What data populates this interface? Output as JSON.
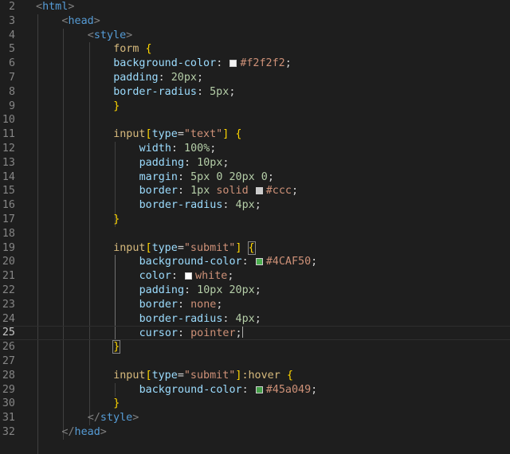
{
  "editor": {
    "language": "html",
    "cursor_line": 25,
    "colors": {
      "background": "#1e1e1e",
      "tag": "#569cd6",
      "selector": "#d7ba7d",
      "property": "#9cdcfe",
      "number": "#b5cea8",
      "string": "#ce9178",
      "bracket": "#ffd700",
      "line_number": "#858585"
    },
    "lines": [
      {
        "n": "2",
        "tokens": [
          {
            "t": "<",
            "c": "punct"
          },
          {
            "t": "html",
            "c": "tag"
          },
          {
            "t": ">",
            "c": "punct"
          }
        ]
      },
      {
        "n": "3",
        "tokens": [
          {
            "t": "<",
            "c": "punct"
          },
          {
            "t": "head",
            "c": "tag"
          },
          {
            "t": ">",
            "c": "punct"
          }
        ]
      },
      {
        "n": "4",
        "tokens": [
          {
            "t": "<",
            "c": "punct"
          },
          {
            "t": "style",
            "c": "tag"
          },
          {
            "t": ">",
            "c": "punct"
          }
        ]
      },
      {
        "n": "5",
        "tokens": [
          {
            "t": "form",
            "c": "sel"
          },
          {
            "t": " ",
            "c": "text"
          },
          {
            "t": "{",
            "c": "br1"
          }
        ]
      },
      {
        "n": "6",
        "tokens": [
          {
            "t": "background-color",
            "c": "prop"
          },
          {
            "t": ": ",
            "c": "text"
          },
          {
            "swatch": "#f2f2f2"
          },
          {
            "t": "#f2f2f2",
            "c": "str"
          },
          {
            "t": ";",
            "c": "text"
          }
        ]
      },
      {
        "n": "7",
        "tokens": [
          {
            "t": "padding",
            "c": "prop"
          },
          {
            "t": ": ",
            "c": "text"
          },
          {
            "t": "20px",
            "c": "num"
          },
          {
            "t": ";",
            "c": "text"
          }
        ]
      },
      {
        "n": "8",
        "tokens": [
          {
            "t": "border-radius",
            "c": "prop"
          },
          {
            "t": ": ",
            "c": "text"
          },
          {
            "t": "5px",
            "c": "num"
          },
          {
            "t": ";",
            "c": "text"
          }
        ]
      },
      {
        "n": "9",
        "tokens": [
          {
            "t": "}",
            "c": "br1"
          }
        ]
      },
      {
        "n": "10",
        "tokens": []
      },
      {
        "n": "11",
        "tokens": [
          {
            "t": "input",
            "c": "sel"
          },
          {
            "t": "[",
            "c": "br1"
          },
          {
            "t": "type",
            "c": "prop"
          },
          {
            "t": "=",
            "c": "text"
          },
          {
            "t": "\"text\"",
            "c": "str"
          },
          {
            "t": "]",
            "c": "br1"
          },
          {
            "t": " ",
            "c": "text"
          },
          {
            "t": "{",
            "c": "br1"
          }
        ]
      },
      {
        "n": "12",
        "tokens": [
          {
            "t": "width",
            "c": "prop"
          },
          {
            "t": ": ",
            "c": "text"
          },
          {
            "t": "100%",
            "c": "num"
          },
          {
            "t": ";",
            "c": "text"
          }
        ]
      },
      {
        "n": "13",
        "tokens": [
          {
            "t": "padding",
            "c": "prop"
          },
          {
            "t": ": ",
            "c": "text"
          },
          {
            "t": "10px",
            "c": "num"
          },
          {
            "t": ";",
            "c": "text"
          }
        ]
      },
      {
        "n": "14",
        "tokens": [
          {
            "t": "margin",
            "c": "prop"
          },
          {
            "t": ": ",
            "c": "text"
          },
          {
            "t": "5px 0 20px 0",
            "c": "num"
          },
          {
            "t": ";",
            "c": "text"
          }
        ]
      },
      {
        "n": "15",
        "tokens": [
          {
            "t": "border",
            "c": "prop"
          },
          {
            "t": ": ",
            "c": "text"
          },
          {
            "t": "1px",
            "c": "num"
          },
          {
            "t": " solid ",
            "c": "str"
          },
          {
            "swatch": "#cccccc"
          },
          {
            "t": "#ccc",
            "c": "str"
          },
          {
            "t": ";",
            "c": "text"
          }
        ]
      },
      {
        "n": "16",
        "tokens": [
          {
            "t": "border-radius",
            "c": "prop"
          },
          {
            "t": ": ",
            "c": "text"
          },
          {
            "t": "4px",
            "c": "num"
          },
          {
            "t": ";",
            "c": "text"
          }
        ]
      },
      {
        "n": "17",
        "tokens": [
          {
            "t": "}",
            "c": "br1"
          }
        ]
      },
      {
        "n": "18",
        "tokens": []
      },
      {
        "n": "19",
        "tokens": [
          {
            "t": "input",
            "c": "sel"
          },
          {
            "t": "[",
            "c": "br1"
          },
          {
            "t": "type",
            "c": "prop"
          },
          {
            "t": "=",
            "c": "text"
          },
          {
            "t": "\"submit\"",
            "c": "str"
          },
          {
            "t": "]",
            "c": "br1"
          },
          {
            "t": " ",
            "c": "text"
          },
          {
            "t": "{",
            "c": "br1",
            "box": true
          }
        ]
      },
      {
        "n": "20",
        "tokens": [
          {
            "t": "background-color",
            "c": "prop"
          },
          {
            "t": ": ",
            "c": "text"
          },
          {
            "swatch": "#4caf50"
          },
          {
            "t": "#4CAF50",
            "c": "str"
          },
          {
            "t": ";",
            "c": "text"
          }
        ]
      },
      {
        "n": "21",
        "tokens": [
          {
            "t": "color",
            "c": "prop"
          },
          {
            "t": ": ",
            "c": "text"
          },
          {
            "swatch": "#ffffff"
          },
          {
            "t": "white",
            "c": "str"
          },
          {
            "t": ";",
            "c": "text"
          }
        ]
      },
      {
        "n": "22",
        "tokens": [
          {
            "t": "padding",
            "c": "prop"
          },
          {
            "t": ": ",
            "c": "text"
          },
          {
            "t": "10px 20px",
            "c": "num"
          },
          {
            "t": ";",
            "c": "text"
          }
        ]
      },
      {
        "n": "23",
        "tokens": [
          {
            "t": "border",
            "c": "prop"
          },
          {
            "t": ": ",
            "c": "text"
          },
          {
            "t": "none",
            "c": "str"
          },
          {
            "t": ";",
            "c": "text"
          }
        ]
      },
      {
        "n": "24",
        "tokens": [
          {
            "t": "border-radius",
            "c": "prop"
          },
          {
            "t": ": ",
            "c": "text"
          },
          {
            "t": "4px",
            "c": "num"
          },
          {
            "t": ";",
            "c": "text"
          }
        ]
      },
      {
        "n": "25",
        "tokens": [
          {
            "t": "cursor",
            "c": "prop"
          },
          {
            "t": ": ",
            "c": "text"
          },
          {
            "t": "pointer",
            "c": "str"
          },
          {
            "t": ";",
            "c": "text"
          },
          {
            "cursor": true
          }
        ]
      },
      {
        "n": "26",
        "tokens": [
          {
            "t": "}",
            "c": "br1",
            "box": true
          }
        ]
      },
      {
        "n": "27",
        "tokens": []
      },
      {
        "n": "28",
        "tokens": [
          {
            "t": "input",
            "c": "sel"
          },
          {
            "t": "[",
            "c": "br1"
          },
          {
            "t": "type",
            "c": "prop"
          },
          {
            "t": "=",
            "c": "text"
          },
          {
            "t": "\"submit\"",
            "c": "str"
          },
          {
            "t": "]",
            "c": "br1"
          },
          {
            "t": ":hover",
            "c": "sel"
          },
          {
            "t": " ",
            "c": "text"
          },
          {
            "t": "{",
            "c": "br1"
          }
        ]
      },
      {
        "n": "29",
        "tokens": [
          {
            "t": "background-color",
            "c": "prop"
          },
          {
            "t": ": ",
            "c": "text"
          },
          {
            "swatch": "#45a049"
          },
          {
            "t": "#45a049",
            "c": "str"
          },
          {
            "t": ";",
            "c": "text"
          }
        ]
      },
      {
        "n": "30",
        "tokens": [
          {
            "t": "}",
            "c": "br1"
          }
        ]
      },
      {
        "n": "31",
        "tokens": [
          {
            "t": "</",
            "c": "punct"
          },
          {
            "t": "style",
            "c": "tag"
          },
          {
            "t": ">",
            "c": "punct"
          }
        ]
      },
      {
        "n": "32",
        "tokens": [
          {
            "t": "</",
            "c": "punct"
          },
          {
            "t": "head",
            "c": "tag"
          },
          {
            "t": ">",
            "c": "punct"
          }
        ]
      }
    ]
  }
}
